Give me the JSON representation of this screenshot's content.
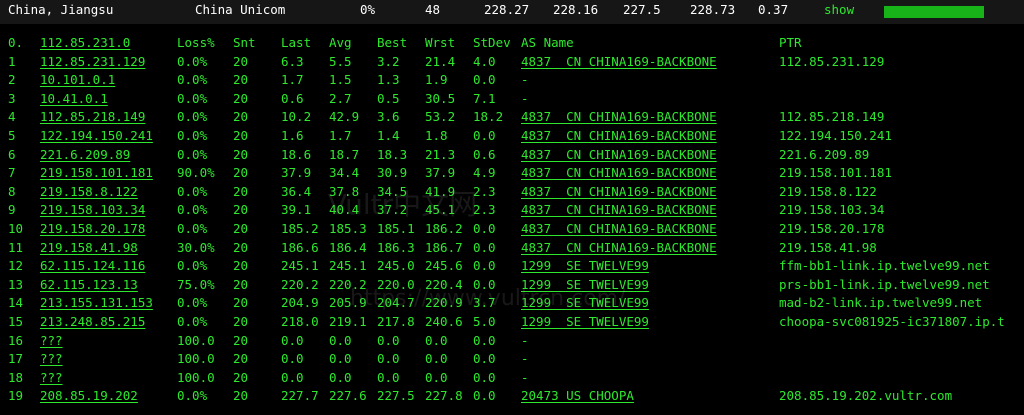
{
  "top_bar": {
    "location": "China, Jiangsu",
    "isp": "China Unicom",
    "loss": "0%",
    "sent": "48",
    "last": "228.27",
    "avg": "228.16",
    "best": "227.5",
    "wrst": "228.73",
    "stdev": "0.37",
    "show_label": "show",
    "bar_fill_percent": 100,
    "bar_color": "#18b318"
  },
  "headers": {
    "num": "0.",
    "ip": "112.85.231.0",
    "loss": "Loss%",
    "snt": "Snt",
    "last": "Last",
    "avg": "Avg",
    "best": "Best",
    "wrst": "Wrst",
    "stdev": "StDev",
    "as_name": "AS Name",
    "ptr": "PTR"
  },
  "hops": [
    {
      "num": "1",
      "ip": "112.85.231.129",
      "loss": "0.0%",
      "snt": "20",
      "last": "6.3",
      "avg": "5.5",
      "best": "3.2",
      "wrst": "21.4",
      "stdev": "4.0",
      "as": "4837  CN CHINA169-BACKBONE",
      "ptr": "112.85.231.129"
    },
    {
      "num": "2",
      "ip": "10.101.0.1",
      "loss": "0.0%",
      "snt": "20",
      "last": "1.7",
      "avg": "1.5",
      "best": "1.3",
      "wrst": "1.9",
      "stdev": "0.0",
      "as": "-",
      "ptr": ""
    },
    {
      "num": "3",
      "ip": "10.41.0.1",
      "loss": "0.0%",
      "snt": "20",
      "last": "0.6",
      "avg": "2.7",
      "best": "0.5",
      "wrst": "30.5",
      "stdev": "7.1",
      "as": "-",
      "ptr": ""
    },
    {
      "num": "4",
      "ip": "112.85.218.149",
      "loss": "0.0%",
      "snt": "20",
      "last": "10.2",
      "avg": "42.9",
      "best": "3.6",
      "wrst": "53.2",
      "stdev": "18.2",
      "as": "4837  CN CHINA169-BACKBONE",
      "ptr": "112.85.218.149"
    },
    {
      "num": "5",
      "ip": "122.194.150.241",
      "loss": "0.0%",
      "snt": "20",
      "last": "1.6",
      "avg": "1.7",
      "best": "1.4",
      "wrst": "1.8",
      "stdev": "0.0",
      "as": "4837  CN CHINA169-BACKBONE",
      "ptr": "122.194.150.241"
    },
    {
      "num": "6",
      "ip": "221.6.209.89",
      "loss": "0.0%",
      "snt": "20",
      "last": "18.6",
      "avg": "18.7",
      "best": "18.3",
      "wrst": "21.3",
      "stdev": "0.6",
      "as": "4837  CN CHINA169-BACKBONE",
      "ptr": "221.6.209.89"
    },
    {
      "num": "7",
      "ip": "219.158.101.181",
      "loss": "90.0%",
      "snt": "20",
      "last": "37.9",
      "avg": "34.4",
      "best": "30.9",
      "wrst": "37.9",
      "stdev": "4.9",
      "as": "4837  CN CHINA169-BACKBONE",
      "ptr": "219.158.101.181"
    },
    {
      "num": "8",
      "ip": "219.158.8.122",
      "loss": "0.0%",
      "snt": "20",
      "last": "36.4",
      "avg": "37.8",
      "best": "34.5",
      "wrst": "41.9",
      "stdev": "2.3",
      "as": "4837  CN CHINA169-BACKBONE",
      "ptr": "219.158.8.122"
    },
    {
      "num": "9",
      "ip": "219.158.103.34",
      "loss": "0.0%",
      "snt": "20",
      "last": "39.1",
      "avg": "40.4",
      "best": "37.2",
      "wrst": "45.1",
      "stdev": "2.3",
      "as": "4837  CN CHINA169-BACKBONE",
      "ptr": "219.158.103.34"
    },
    {
      "num": "10",
      "ip": "219.158.20.178",
      "loss": "0.0%",
      "snt": "20",
      "last": "185.2",
      "avg": "185.3",
      "best": "185.1",
      "wrst": "186.2",
      "stdev": "0.0",
      "as": "4837  CN CHINA169-BACKBONE",
      "ptr": "219.158.20.178"
    },
    {
      "num": "11",
      "ip": "219.158.41.98",
      "loss": "30.0%",
      "snt": "20",
      "last": "186.6",
      "avg": "186.4",
      "best": "186.3",
      "wrst": "186.7",
      "stdev": "0.0",
      "as": "4837  CN CHINA169-BACKBONE",
      "ptr": "219.158.41.98"
    },
    {
      "num": "12",
      "ip": "62.115.124.116",
      "loss": "0.0%",
      "snt": "20",
      "last": "245.1",
      "avg": "245.1",
      "best": "245.0",
      "wrst": "245.6",
      "stdev": "0.0",
      "as": "1299  SE TWELVE99",
      "ptr": "ffm-bb1-link.ip.twelve99.net"
    },
    {
      "num": "13",
      "ip": "62.115.123.13",
      "loss": "75.0%",
      "snt": "20",
      "last": "220.2",
      "avg": "220.2",
      "best": "220.0",
      "wrst": "220.4",
      "stdev": "0.0",
      "as": "1299  SE TWELVE99",
      "ptr": "prs-bb1-link.ip.twelve99.net"
    },
    {
      "num": "14",
      "ip": "213.155.131.153",
      "loss": "0.0%",
      "snt": "20",
      "last": "204.9",
      "avg": "205.9",
      "best": "204.7",
      "wrst": "220.9",
      "stdev": "3.7",
      "as": "1299  SE TWELVE99",
      "ptr": "mad-b2-link.ip.twelve99.net"
    },
    {
      "num": "15",
      "ip": "213.248.85.215",
      "loss": "0.0%",
      "snt": "20",
      "last": "218.0",
      "avg": "219.1",
      "best": "217.8",
      "wrst": "240.6",
      "stdev": "5.0",
      "as": "1299  SE TWELVE99",
      "ptr": "choopa-svc081925-ic371807.ip.t"
    },
    {
      "num": "16",
      "ip": "???",
      "loss": "100.0",
      "snt": "20",
      "last": "0.0",
      "avg": "0.0",
      "best": "0.0",
      "wrst": "0.0",
      "stdev": "0.0",
      "as": "-",
      "ptr": ""
    },
    {
      "num": "17",
      "ip": "???",
      "loss": "100.0",
      "snt": "20",
      "last": "0.0",
      "avg": "0.0",
      "best": "0.0",
      "wrst": "0.0",
      "stdev": "0.0",
      "as": "-",
      "ptr": ""
    },
    {
      "num": "18",
      "ip": "???",
      "loss": "100.0",
      "snt": "20",
      "last": "0.0",
      "avg": "0.0",
      "best": "0.0",
      "wrst": "0.0",
      "stdev": "0.0",
      "as": "-",
      "ptr": ""
    },
    {
      "num": "19",
      "ip": "208.85.19.202",
      "loss": "0.0%",
      "snt": "20",
      "last": "227.7",
      "avg": "227.6",
      "best": "227.5",
      "wrst": "227.8",
      "stdev": "0.0",
      "as": "20473 US CHOOPA",
      "ptr": "208.85.19.202.vultr.com"
    }
  ],
  "watermark": {
    "line1": "Vultr中文网",
    "line2": "https://www.vultrcn.com/"
  }
}
